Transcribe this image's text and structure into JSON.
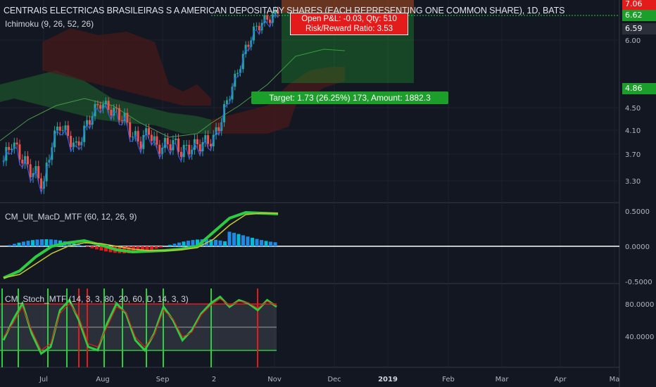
{
  "header": {
    "title": "CENTRAIS ELECTRICAS BRASILEIRAS S A AMERICAN DEPOSITARY SHARES (EACH REPRESENTING ONE COMMON SHARE), 1D, BATS",
    "indicator": "Ichimoku (9, 26, 52, 26)"
  },
  "trade_box": {
    "pnl": "Open P&L: -0.03, Qty: 510",
    "rr": "Risk/Reward Ratio: 3.53",
    "target": "Target: 1.73 (26.25%) 173, Amount: 1882.3"
  },
  "price_tags": {
    "stop": "7.06",
    "tp": "6.62",
    "last": "6.59",
    "entry": "4.86"
  },
  "panels": {
    "macd_label": "CM_Ult_MacD_MTF (60, 12, 26, 9)",
    "stoch_label": "CM_Stoch_MTF (14, 3, 3, 80, 20, 60, D, 14, 3, 3)"
  },
  "colors": {
    "bg": "#131722",
    "up": "#26a69a",
    "down": "#ef5350",
    "green": "#2ecc40",
    "red": "#e31b1b",
    "cloud_green": "#1b4d2a",
    "cloud_red": "#4a1a1a",
    "grid": "#1e222d"
  },
  "chart_data": [
    {
      "type": "candlestick",
      "title": "CENTRAIS ELECTRICAS BRASILEIRAS S A AMERICAN DEPOSITARY SHARES (EACH REPRESENTING ONE COMMON SHARE), 1D, BATS",
      "y_ticks": [
        "6.00",
        "4.50",
        "4.10",
        "3.70",
        "3.30"
      ],
      "x_ticks": [
        "Jul",
        "Aug",
        "Sep",
        "2",
        "Nov",
        "Dec",
        "2019",
        "Feb",
        "Mar",
        "Apr",
        "Ma"
      ],
      "ylim": [
        3.1,
        7.1
      ],
      "close_approx": [
        3.6,
        3.9,
        3.7,
        3.5,
        3.4,
        3.25,
        3.9,
        4.2,
        4.0,
        3.8,
        4.1,
        4.4,
        4.6,
        4.5,
        4.4,
        4.3,
        4.0,
        3.9,
        4.1,
        3.8,
        3.85,
        3.9,
        3.75,
        3.8,
        3.85,
        3.9,
        3.95,
        4.3,
        4.8,
        5.3,
        5.8,
        6.2,
        6.4,
        6.5,
        6.59
      ]
    },
    {
      "type": "line",
      "title": "CM_Ult_MacD_MTF (60, 12, 26, 9)",
      "y_ticks": [
        "0.5000",
        "0.0000",
        "-0.5000"
      ],
      "ylim": [
        -0.5,
        0.5
      ],
      "series": [
        {
          "values": [
            -0.45,
            -0.35,
            -0.15,
            0.0,
            0.05,
            0.08,
            0.02,
            -0.05,
            -0.08,
            -0.07,
            -0.06,
            -0.04,
            0.0,
            0.2,
            0.4,
            0.48,
            0.47,
            0.46
          ]
        },
        {
          "values": [
            -0.45,
            -0.4,
            -0.25,
            -0.1,
            0.0,
            0.05,
            0.04,
            0.0,
            -0.04,
            -0.06,
            -0.06,
            -0.05,
            -0.02,
            0.1,
            0.3,
            0.45,
            0.47,
            0.47
          ]
        }
      ]
    },
    {
      "type": "line",
      "title": "CM_Stoch_MTF (14, 3, 3, 80, 20, 60, D, 14, 3, 3)",
      "y_ticks": [
        "80.0000",
        "40.0000"
      ],
      "ylim": [
        0,
        100
      ],
      "series": [
        {
          "values": [
            30,
            60,
            85,
            40,
            10,
            20,
            75,
            90,
            60,
            20,
            15,
            55,
            85,
            70,
            30,
            15,
            40,
            80,
            60,
            30,
            45,
            70,
            85,
            95,
            80,
            90,
            85,
            75,
            90,
            80
          ]
        },
        {
          "values": [
            35,
            55,
            80,
            45,
            15,
            25,
            70,
            85,
            65,
            25,
            20,
            50,
            80,
            72,
            35,
            20,
            38,
            75,
            62,
            35,
            42,
            68,
            82,
            92,
            82,
            88,
            86,
            78,
            88,
            82
          ]
        }
      ]
    }
  ]
}
